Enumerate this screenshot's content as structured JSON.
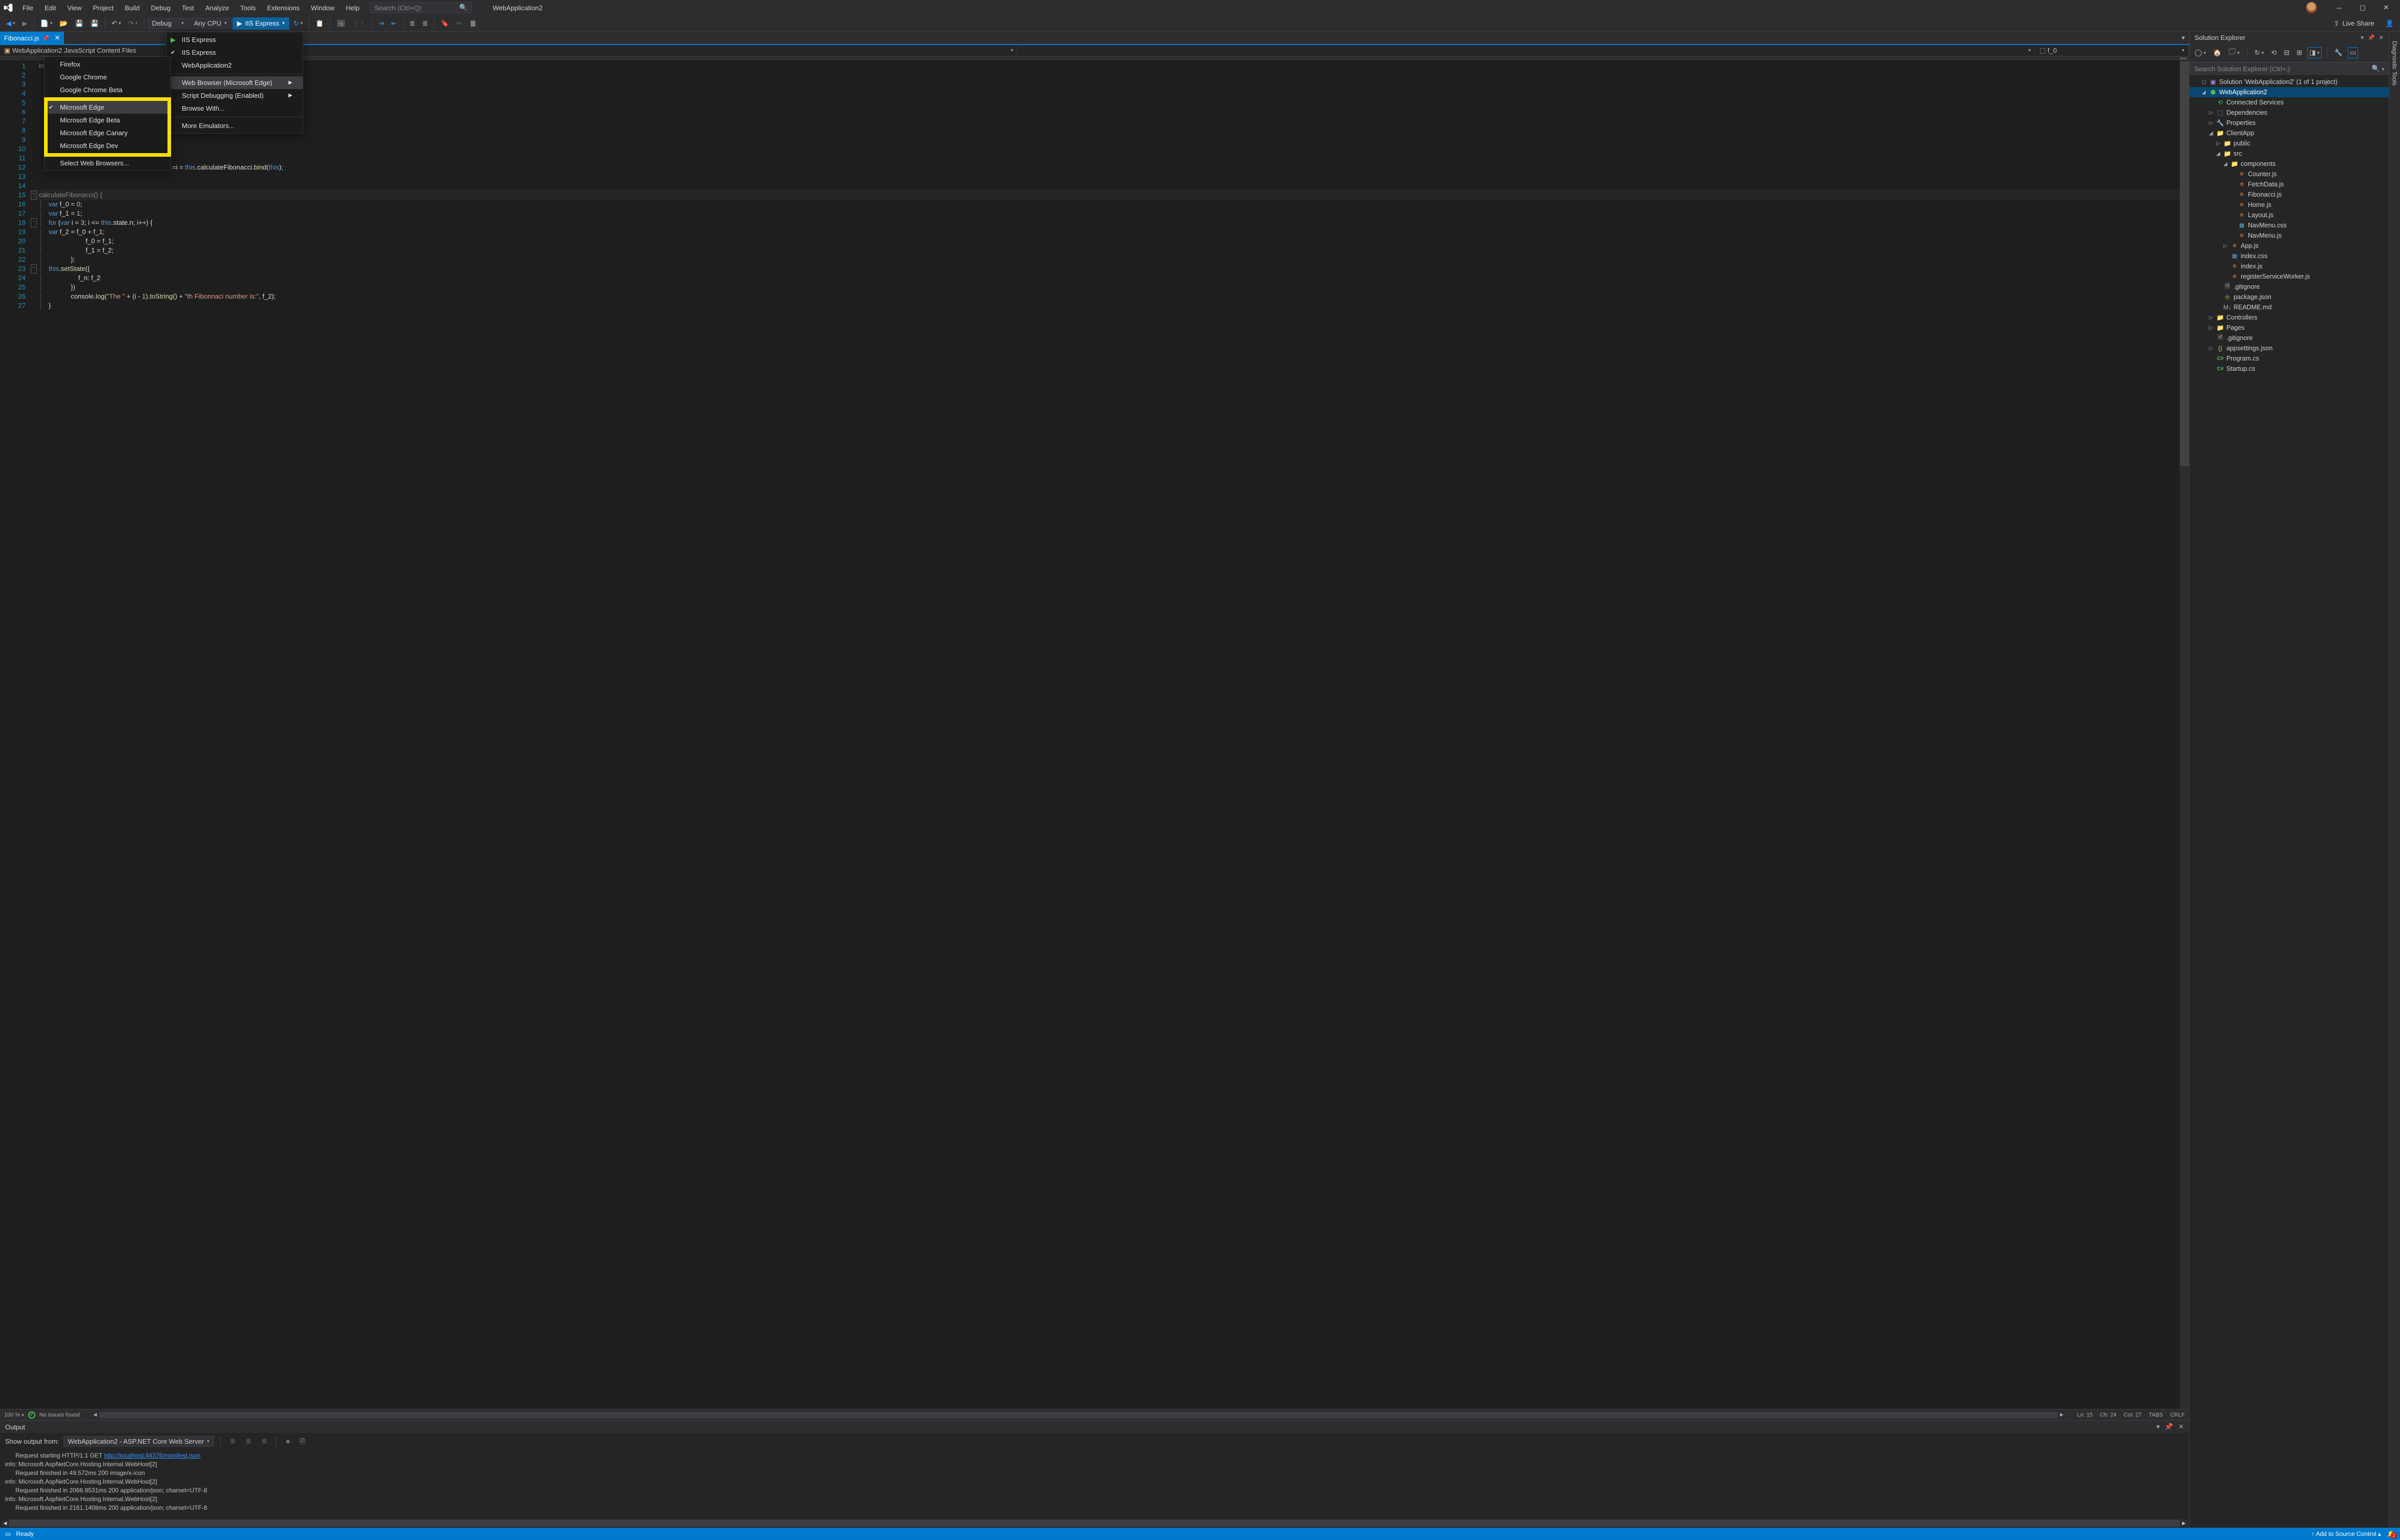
{
  "titlebar": {
    "menus": [
      "File",
      "Edit",
      "View",
      "Project",
      "Build",
      "Debug",
      "Test",
      "Analyze",
      "Tools",
      "Extensions",
      "Window",
      "Help"
    ],
    "search_placeholder": "Search (Ctrl+Q)",
    "app_title": "WebApplication2"
  },
  "toolbar": {
    "config": "Debug",
    "platform": "Any CPU",
    "run_label": "IIS Express",
    "live_share": "Live Share"
  },
  "run_dropdown": {
    "items": [
      {
        "label": "IIS Express",
        "icon": "play"
      },
      {
        "label": "IIS Express",
        "icon": "check"
      },
      {
        "label": "WebApplication2"
      }
    ],
    "items2": [
      {
        "label": "Web Browser (Microsoft Edge)",
        "submenu": true,
        "hover": true
      },
      {
        "label": "Script Debugging (Enabled)",
        "submenu": true
      },
      {
        "label": "Browse With..."
      }
    ],
    "items3": [
      {
        "label": "More Emulators..."
      }
    ]
  },
  "browser_submenu": {
    "items": [
      {
        "label": "Firefox"
      },
      {
        "label": "Google Chrome"
      },
      {
        "label": "Google Chrome Beta"
      }
    ],
    "edge_items": [
      {
        "label": "Microsoft Edge",
        "checked": true,
        "hover": true
      },
      {
        "label": "Microsoft Edge Beta"
      },
      {
        "label": "Microsoft Edge Canary"
      },
      {
        "label": "Microsoft Edge Dev"
      }
    ],
    "last": [
      {
        "label": "Select Web Browsers..."
      }
    ]
  },
  "tabs": {
    "active": "Fibonacci.js",
    "pinned": true
  },
  "navbar": {
    "scope": "WebApplication2 JavaScript Content Files",
    "member": "f_0",
    "member_icon": "⬚"
  },
  "code": {
    "lines": [
      "import React, { Component }",
      "",
      "",
      "",
      "",
      "",
      "",
      "",
      "",
      "",
      "",
      "=i = this.calculateFibonacci.bind(this);",
      "",
      "",
      "calculateFibonacci() {",
      "    var f_0 = 0;",
      "    var f_1 = 1;",
      "    for (var i = 3; i <= this.state.n; i++) {",
      "        var f_2 = f_0 + f_1;",
      "        f_0 = f_1;",
      "        f_1 = f_2;",
      "    };",
      "    this.setState({",
      "        f_n: f_2",
      "    })",
      "    console.log(\"The \" + (i - 1).toString() + \"th Fibonnaci number is:\", f_2);",
      "}"
    ]
  },
  "code_status": {
    "zoom": "100 %",
    "issues": "No issues found",
    "ln": "Ln: 15",
    "ch": "Ch: 24",
    "col": "Col: 27",
    "tabs": "TABS",
    "crlf": "CRLF"
  },
  "output": {
    "title": "Output",
    "from_label": "Show output from:",
    "from_value": "WebApplication2 - ASP.NET Core Web Server",
    "lines": [
      {
        "pre": "      Request starting HTTP/1.1 GET ",
        "link": "http://localhost:44376/manifest.json",
        "post": ""
      },
      {
        "pre": "info: Microsoft.AspNetCore.Hosting.Internal.WebHost[2]"
      },
      {
        "pre": "      Request finished in 49.572ms 200 image/x-icon"
      },
      {
        "pre": "info: Microsoft.AspNetCore.Hosting.Internal.WebHost[2]"
      },
      {
        "pre": "      Request finished in 2066.9531ms 200 application/json; charset=UTF-8"
      },
      {
        "pre": "info: Microsoft.AspNetCore.Hosting.Internal.WebHost[2]"
      },
      {
        "pre": "      Request finished in 2161.1408ms 200 application/json; charset=UTF-8"
      }
    ]
  },
  "solexp": {
    "title": "Solution Explorer",
    "search_placeholder": "Search Solution Explorer (Ctrl+;)",
    "tree": [
      {
        "d": 0,
        "twisty": "▢",
        "icon": "sln",
        "label": "Solution 'WebApplication2' (1 of 1 project)"
      },
      {
        "d": 0,
        "twisty": "◢",
        "icon": "proj",
        "label": "WebApplication2",
        "selected": true
      },
      {
        "d": 1,
        "twisty": "",
        "icon": "conn",
        "label": "Connected Services"
      },
      {
        "d": 1,
        "twisty": "▷",
        "icon": "dep",
        "label": "Dependencies"
      },
      {
        "d": 1,
        "twisty": "▷",
        "icon": "wrench",
        "label": "Properties"
      },
      {
        "d": 1,
        "twisty": "◢",
        "icon": "folder",
        "label": "ClientApp"
      },
      {
        "d": 2,
        "twisty": "▷",
        "icon": "folder",
        "label": "public"
      },
      {
        "d": 2,
        "twisty": "◢",
        "icon": "folder",
        "label": "src"
      },
      {
        "d": 3,
        "twisty": "◢",
        "icon": "folder",
        "label": "components"
      },
      {
        "d": 4,
        "twisty": "",
        "icon": "js",
        "label": "Counter.js"
      },
      {
        "d": 4,
        "twisty": "",
        "icon": "js",
        "label": "FetchData.js"
      },
      {
        "d": 4,
        "twisty": "",
        "icon": "js",
        "label": "Fibonacci.js"
      },
      {
        "d": 4,
        "twisty": "",
        "icon": "js",
        "label": "Home.js"
      },
      {
        "d": 4,
        "twisty": "",
        "icon": "js",
        "label": "Layout.js"
      },
      {
        "d": 4,
        "twisty": "",
        "icon": "css",
        "label": "NavMenu.css"
      },
      {
        "d": 4,
        "twisty": "",
        "icon": "js",
        "label": "NavMenu.js"
      },
      {
        "d": 3,
        "twisty": "▷",
        "icon": "js",
        "label": "App.js"
      },
      {
        "d": 3,
        "twisty": "",
        "icon": "css",
        "label": "index.css"
      },
      {
        "d": 3,
        "twisty": "",
        "icon": "js",
        "label": "index.js"
      },
      {
        "d": 3,
        "twisty": "",
        "icon": "js",
        "label": "registerServiceWorker.js"
      },
      {
        "d": 2,
        "twisty": "",
        "icon": "file",
        "label": ".gitignore"
      },
      {
        "d": 2,
        "twisty": "",
        "icon": "pkg",
        "label": "package.json"
      },
      {
        "d": 2,
        "twisty": "",
        "icon": "md",
        "label": "README.md"
      },
      {
        "d": 1,
        "twisty": "▷",
        "icon": "folder",
        "label": "Controllers"
      },
      {
        "d": 1,
        "twisty": "▷",
        "icon": "folder",
        "label": "Pages"
      },
      {
        "d": 1,
        "twisty": "",
        "icon": "file",
        "label": ".gitignore"
      },
      {
        "d": 1,
        "twisty": "▷",
        "icon": "json",
        "label": "appsettings.json"
      },
      {
        "d": 1,
        "twisty": "",
        "icon": "cs",
        "label": "Program.cs"
      },
      {
        "d": 1,
        "twisty": "",
        "icon": "cs",
        "label": "Startup.cs"
      }
    ]
  },
  "right_dock": {
    "tab": "Diagnostic Tools"
  },
  "statusbar": {
    "ready": "Ready",
    "add_to_source": "Add to Source Control",
    "notif_count": "2"
  }
}
